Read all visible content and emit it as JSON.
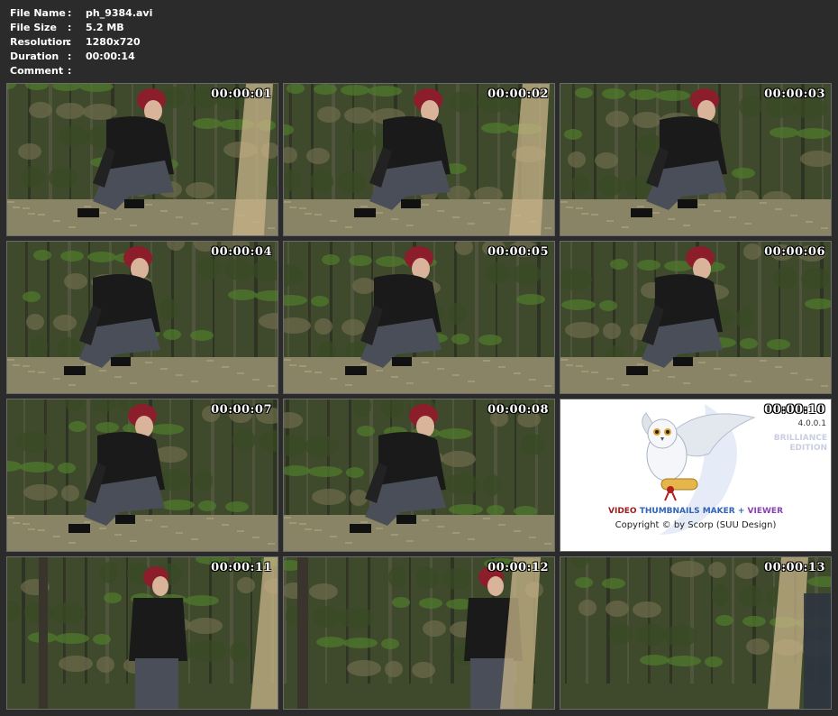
{
  "file_info": {
    "rows": [
      {
        "label": "File Name",
        "value": "ph_9384.avi"
      },
      {
        "label": "File Size",
        "value": "5.2 MB"
      },
      {
        "label": "Resolution",
        "value": "1280x720"
      },
      {
        "label": "Duration",
        "value": "00:00:14"
      },
      {
        "label": "Comment",
        "value": ""
      }
    ]
  },
  "thumbnails": [
    {
      "timestamp": "00:00:01",
      "scene": "crouching"
    },
    {
      "timestamp": "00:00:02",
      "scene": "crouching"
    },
    {
      "timestamp": "00:00:03",
      "scene": "crouching"
    },
    {
      "timestamp": "00:00:04",
      "scene": "crouching"
    },
    {
      "timestamp": "00:00:05",
      "scene": "crouching"
    },
    {
      "timestamp": "00:00:06",
      "scene": "crouching"
    },
    {
      "timestamp": "00:00:07",
      "scene": "crouching"
    },
    {
      "timestamp": "00:00:08",
      "scene": "crouching"
    },
    {
      "timestamp": "00:00:10",
      "scene": "logo"
    },
    {
      "timestamp": "00:00:11",
      "scene": "standing"
    },
    {
      "timestamp": "00:00:12",
      "scene": "standing-edge"
    },
    {
      "timestamp": "00:00:13",
      "scene": "foliage"
    }
  ],
  "logo": {
    "version": "4.0.0.1",
    "edition_line1": "BRILLIANCE",
    "edition_line2": "EDITION",
    "brand_word1": "VIDEO",
    "brand_word2": "THUMBNAILS MAKER",
    "brand_plus": "+",
    "brand_word3": "VIEWER",
    "copyright": "Copyright © by Scorp (SUU Design)"
  },
  "colors": {
    "background": "#2b2b2b",
    "foliage": "#3f4a2c",
    "jacket": "#1a1a1a",
    "hair": "#8b1e2a",
    "ground": "#8a8466"
  }
}
